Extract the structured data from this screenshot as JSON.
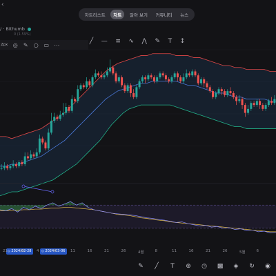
{
  "header": {
    "tabs": [
      {
        "label": "차트리스트",
        "active": false
      },
      {
        "label": "차트",
        "active": true
      },
      {
        "label": "알아 보기",
        "active": false
      },
      {
        "label": "커뮤니티",
        "active": false
      },
      {
        "label": "뉴스",
        "active": false
      }
    ]
  },
  "symbol": {
    "title": "/ · Bithumb",
    "sub": "0 (1.59%)"
  },
  "drawing_toolbar": {
    "width_label": "2px",
    "icons": [
      "target-icon",
      "pen-icon",
      "lock-icon",
      "trash-icon",
      "more-icon"
    ]
  },
  "tools": [
    "trend-line-icon",
    "horizontal-line-icon",
    "fib-icon",
    "pattern-icon",
    "projection-icon",
    "brush-icon",
    "text-icon",
    "measure-icon"
  ],
  "x_axis": {
    "labels": [
      "21",
      "26",
      "4",
      "8",
      "11",
      "16",
      "21",
      "26",
      "4월",
      "8",
      "11",
      "16",
      "21",
      "26",
      "5월",
      "6"
    ]
  },
  "date_range": {
    "start": "◇ 2024-02-28",
    "end": "◇ 2024-03-06"
  },
  "bottom_toolbar": {
    "icons": [
      "pen-icon",
      "line-icon",
      "text-icon",
      "add-icon",
      "alert-icon",
      "chart-type-icon",
      "layers-icon",
      "sync-icon",
      "eye-icon"
    ]
  },
  "chart_data": {
    "type": "candlestick",
    "style": {
      "up": "#26a69a",
      "down": "#ef5350",
      "bb_upper": "#e04848",
      "bb_lower": "#22b28a",
      "bb_mid": "#4a78d8",
      "ma": "#e6c04a"
    },
    "candles": [
      [
        20,
        20,
        22,
        19
      ],
      [
        20,
        21,
        23,
        19
      ],
      [
        21,
        20,
        22,
        19
      ],
      [
        20,
        21,
        22,
        19
      ],
      [
        21,
        22,
        24,
        20
      ],
      [
        22,
        21,
        23,
        20
      ],
      [
        21,
        23,
        24,
        20
      ],
      [
        23,
        22,
        24,
        21
      ],
      [
        22,
        26,
        28,
        21
      ],
      [
        26,
        25,
        28,
        24
      ],
      [
        25,
        27,
        29,
        24
      ],
      [
        27,
        26,
        28,
        25
      ],
      [
        26,
        28,
        30,
        25
      ],
      [
        28,
        35,
        37,
        27
      ],
      [
        35,
        33,
        36,
        32
      ],
      [
        33,
        30,
        34,
        29
      ],
      [
        30,
        38,
        40,
        29
      ],
      [
        38,
        44,
        48,
        37
      ],
      [
        44,
        46,
        48,
        43
      ],
      [
        46,
        45,
        47,
        44
      ],
      [
        45,
        47,
        49,
        44
      ],
      [
        47,
        48,
        53,
        46
      ],
      [
        48,
        51,
        53,
        47
      ],
      [
        51,
        49,
        52,
        48
      ],
      [
        49,
        55,
        57,
        48
      ],
      [
        55,
        54,
        56,
        53
      ],
      [
        54,
        60,
        62,
        53
      ],
      [
        60,
        62,
        63,
        59
      ],
      [
        62,
        61,
        63,
        60
      ],
      [
        61,
        64,
        66,
        60
      ],
      [
        64,
        62,
        65,
        61
      ],
      [
        62,
        66,
        67,
        61
      ],
      [
        66,
        68,
        70,
        65
      ],
      [
        68,
        67,
        69,
        66
      ],
      [
        67,
        66,
        69,
        65
      ],
      [
        66,
        67,
        68,
        65
      ],
      [
        67,
        69,
        71,
        66
      ],
      [
        69,
        71,
        75,
        68
      ],
      [
        71,
        68,
        72,
        67
      ],
      [
        68,
        64,
        69,
        63
      ],
      [
        64,
        66,
        67,
        63
      ],
      [
        66,
        62,
        67,
        61
      ],
      [
        62,
        59,
        63,
        58
      ],
      [
        59,
        62,
        63,
        58
      ],
      [
        62,
        58,
        63,
        56
      ],
      [
        58,
        56,
        60,
        55
      ],
      [
        56,
        61,
        62,
        55
      ],
      [
        61,
        64,
        65,
        60
      ],
      [
        64,
        66,
        67,
        63
      ],
      [
        66,
        65,
        67,
        63
      ],
      [
        65,
        67,
        68,
        64
      ],
      [
        67,
        66,
        68,
        65
      ],
      [
        66,
        64,
        67,
        63
      ],
      [
        64,
        66,
        67,
        63
      ],
      [
        66,
        68,
        69,
        65
      ],
      [
        68,
        67,
        69,
        66
      ],
      [
        67,
        65,
        68,
        64
      ],
      [
        65,
        64,
        66,
        63
      ],
      [
        64,
        66,
        67,
        63
      ],
      [
        66,
        68,
        69,
        65
      ],
      [
        68,
        66,
        69,
        64
      ],
      [
        66,
        64,
        67,
        63
      ],
      [
        64,
        66,
        68,
        63
      ],
      [
        66,
        68,
        70,
        65
      ],
      [
        68,
        67,
        69,
        66
      ],
      [
        67,
        69,
        70,
        66
      ],
      [
        69,
        67,
        70,
        66
      ],
      [
        67,
        63,
        68,
        62
      ],
      [
        63,
        65,
        66,
        62
      ],
      [
        65,
        63,
        66,
        61
      ],
      [
        63,
        61,
        64,
        60
      ],
      [
        61,
        59,
        62,
        58
      ],
      [
        59,
        56,
        60,
        55
      ],
      [
        56,
        58,
        59,
        55
      ],
      [
        58,
        60,
        61,
        57
      ],
      [
        60,
        59,
        61,
        57
      ],
      [
        59,
        57,
        60,
        56
      ],
      [
        57,
        59,
        60,
        56
      ],
      [
        59,
        58,
        61,
        57
      ],
      [
        58,
        56,
        59,
        55
      ],
      [
        56,
        54,
        57,
        52
      ],
      [
        54,
        55,
        57,
        53
      ],
      [
        55,
        52,
        56,
        50
      ],
      [
        52,
        48,
        53,
        46
      ],
      [
        48,
        50,
        52,
        47
      ],
      [
        50,
        53,
        54,
        49
      ],
      [
        53,
        52,
        54,
        51
      ],
      [
        52,
        54,
        55,
        51
      ],
      [
        54,
        52,
        55,
        50
      ],
      [
        52,
        50,
        53,
        49
      ],
      [
        50,
        52,
        53,
        49
      ],
      [
        52,
        54,
        55,
        51
      ],
      [
        54,
        53,
        56,
        52
      ],
      [
        53,
        55,
        57,
        52
      ]
    ],
    "y_range": [
      15,
      80
    ],
    "bands": {
      "upper": [
        36,
        36,
        35,
        36,
        37,
        38,
        39,
        40,
        42,
        44,
        46,
        48,
        51,
        54,
        57,
        60,
        63,
        66,
        69,
        71,
        73,
        74,
        75,
        76,
        77,
        77,
        78,
        78,
        78,
        78,
        77,
        77,
        77,
        76,
        76,
        75,
        74,
        73,
        72,
        72,
        71,
        71,
        70,
        70,
        70,
        70,
        69,
        69
      ],
      "mid": [
        21,
        21,
        22,
        22,
        23,
        24,
        25,
        26,
        28,
        30,
        32,
        34,
        37,
        40,
        43,
        46,
        49,
        52,
        55,
        57,
        59,
        60,
        61,
        62,
        63,
        63,
        64,
        64,
        64,
        64,
        64,
        63,
        62,
        62,
        61,
        60,
        59,
        58,
        58,
        57,
        56,
        56,
        55,
        55,
        55,
        55,
        54,
        54
      ],
      "lower": [
        6,
        7,
        8,
        8,
        9,
        10,
        11,
        12,
        13,
        14,
        16,
        18,
        20,
        22,
        25,
        28,
        31,
        34,
        38,
        42,
        45,
        48,
        50,
        51,
        52,
        52,
        52,
        52,
        52,
        52,
        51,
        50,
        49,
        48,
        47,
        46,
        45,
        44,
        43,
        42,
        41,
        41,
        40,
        40,
        40,
        40,
        40,
        40
      ]
    },
    "indicator": {
      "line": [
        62,
        60,
        64,
        58,
        66,
        62,
        68,
        64,
        70,
        74,
        68,
        72,
        76,
        70,
        74,
        66,
        62,
        60,
        58,
        56,
        55,
        54,
        53,
        52,
        50,
        48,
        47,
        45,
        44,
        42,
        40,
        41,
        38,
        36,
        34,
        35,
        32,
        33,
        30,
        31,
        28,
        29,
        26,
        27,
        24,
        25,
        22,
        23
      ],
      "ma": [
        60,
        60,
        61,
        61,
        62,
        62,
        63,
        63,
        64,
        65,
        65,
        66,
        66,
        65,
        64,
        63,
        62,
        60,
        58,
        56,
        54,
        53,
        52,
        50,
        48,
        47,
        45,
        44,
        43,
        41,
        40,
        39,
        38,
        37,
        36,
        35,
        34,
        33,
        32,
        31,
        30,
        29,
        28,
        27,
        26,
        25,
        24,
        24
      ],
      "levels": [
        70,
        30
      ]
    }
  }
}
